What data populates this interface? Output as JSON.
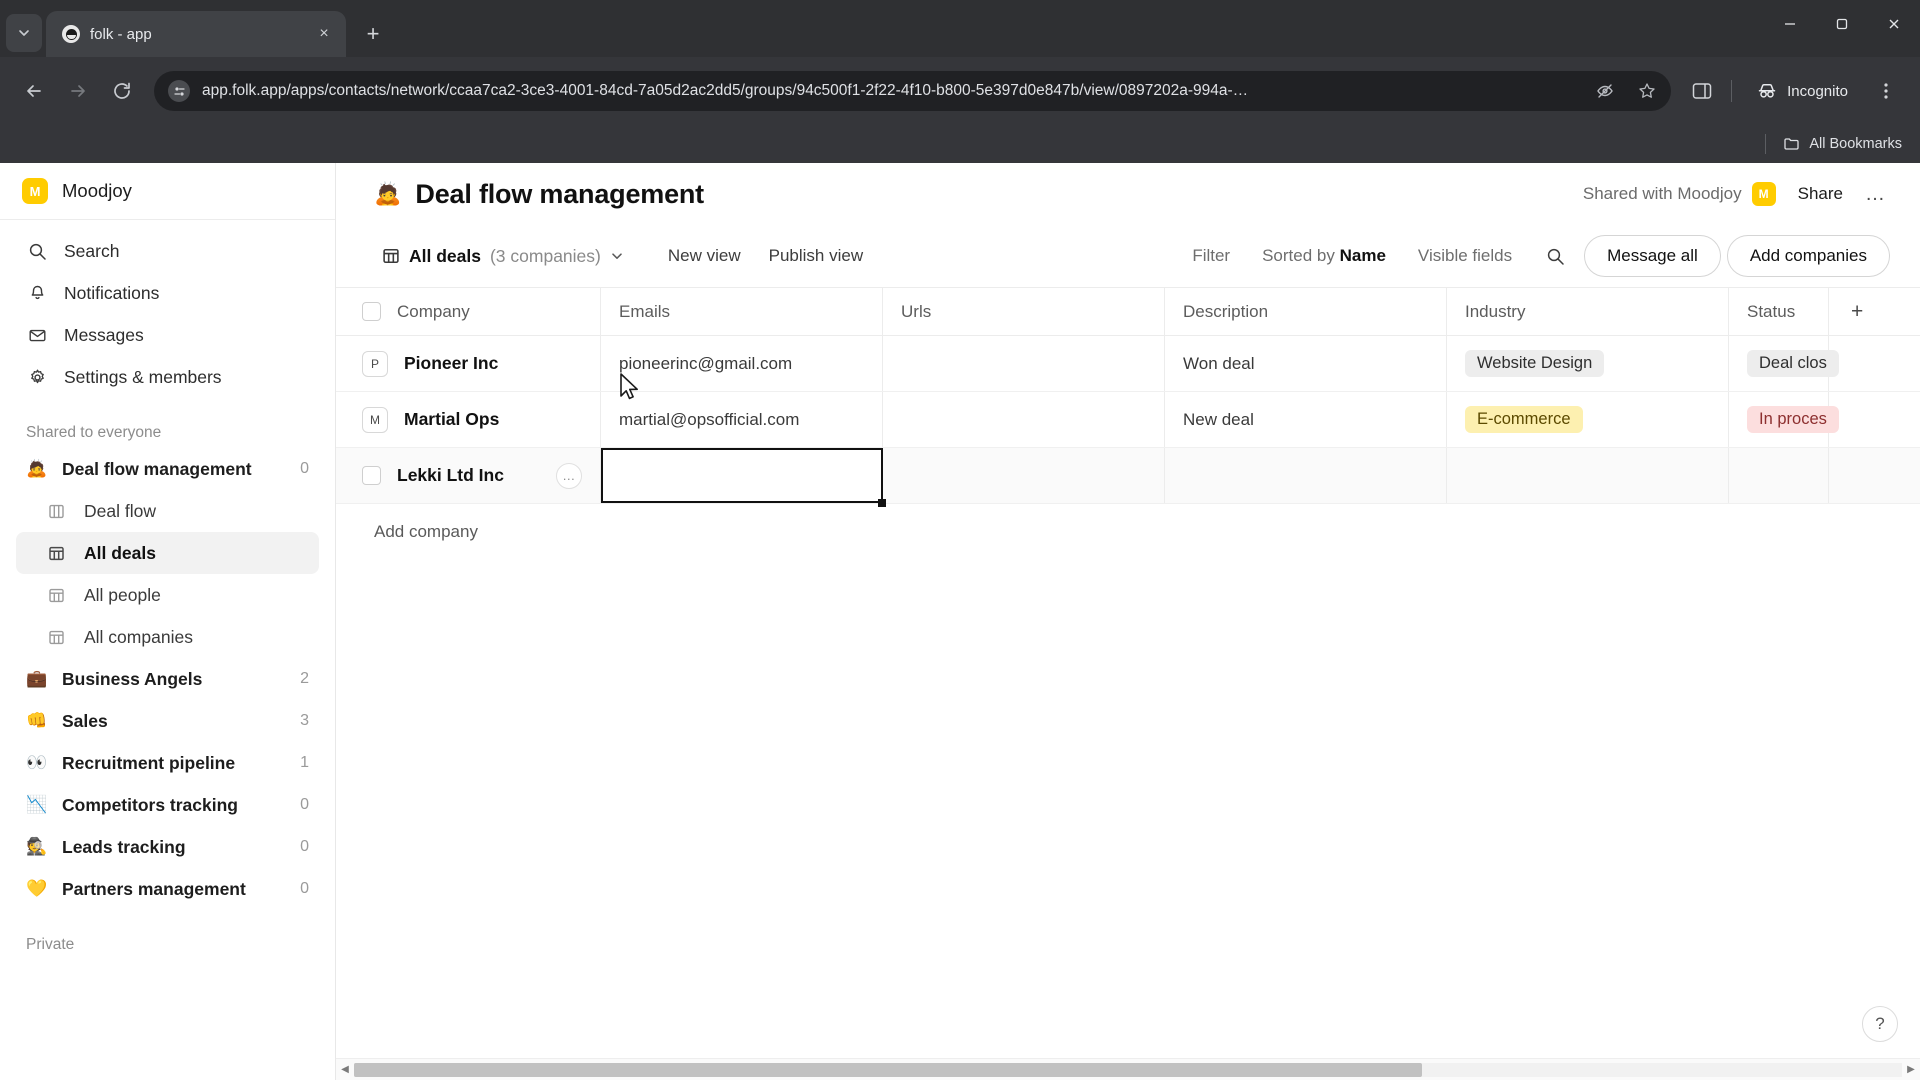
{
  "browser": {
    "tab": {
      "title": "folk - app",
      "favicon": "folk-logo-icon"
    },
    "tab_list_icon": "chevron-down-icon",
    "new_tab_icon": "plus-icon",
    "close_icon": "×",
    "window_controls": {
      "minimize": "—",
      "maximize": "❐",
      "close": "✕"
    },
    "nav": {
      "back": "←",
      "forward": "→",
      "reload": "⟳"
    },
    "omnibox": {
      "site_info_icon": "tune-icon",
      "url": "app.folk.app/apps/contacts/network/ccaa7ca2-3ce3-4001-84cd-7a05d2ac2dd5/groups/94c500f1-2f22-4f10-b800-5e397d0e847b/view/0897202a-994a-…",
      "hide_icon": "eye-slash-icon",
      "bookmark_icon": "star-icon"
    },
    "side_panel_icon": "side-panel-icon",
    "incognito": {
      "label": "Incognito",
      "icon": "incognito-icon"
    },
    "bookmarks": {
      "all_bookmarks": "All Bookmarks",
      "folder_icon": "folder-icon"
    }
  },
  "sidebar": {
    "workspace": {
      "name": "Moodjoy",
      "avatar_letter": "M",
      "avatar_color": "#FFCC00"
    },
    "nav": [
      {
        "label": "Search",
        "icon": "search-icon"
      },
      {
        "label": "Notifications",
        "icon": "bell-icon"
      },
      {
        "label": "Messages",
        "icon": "envelope-icon"
      },
      {
        "label": "Settings & members",
        "icon": "gear-icon"
      }
    ],
    "section_shared": "Shared to everyone",
    "groups": [
      {
        "label": "Deal flow management",
        "emoji": "🙇",
        "count": "0",
        "bold": true
      },
      {
        "label": "Deal flow",
        "icon": "board-icon",
        "sub": true,
        "active": false
      },
      {
        "label": "All deals",
        "icon": "table-icon",
        "sub": true,
        "active": true
      },
      {
        "label": "All people",
        "icon": "table-icon",
        "sub": true,
        "active": false
      },
      {
        "label": "All companies",
        "icon": "table-icon",
        "sub": true,
        "active": false
      },
      {
        "label": "Business Angels",
        "emoji": "💼",
        "count": "2"
      },
      {
        "label": "Sales",
        "emoji": "👊",
        "count": "3"
      },
      {
        "label": "Recruitment pipeline",
        "emoji": "👀",
        "count": "1"
      },
      {
        "label": "Competitors tracking",
        "emoji": "📉",
        "count": "0"
      },
      {
        "label": "Leads tracking",
        "emoji": "🕵️",
        "count": "0"
      },
      {
        "label": "Partners management",
        "emoji": "💛",
        "count": "0"
      }
    ],
    "section_private": "Private"
  },
  "header": {
    "emoji": "🙇",
    "title": "Deal flow management",
    "shared_with": "Shared with Moodjoy",
    "shared_avatar_letter": "M",
    "share_label": "Share",
    "more_icon": "…"
  },
  "toolbar": {
    "view_icon": "table-icon",
    "view_name": "All deals",
    "view_count": "(3 companies)",
    "chevron_icon": "chevron-down-icon",
    "new_view": "New view",
    "publish_view": "Publish view",
    "filter": "Filter",
    "sorted_by_prefix": "Sorted by ",
    "sorted_by_value": "Name",
    "visible_fields": "Visible fields",
    "search_icon": "search-icon",
    "message_all": "Message all",
    "add_companies": "Add companies"
  },
  "table": {
    "columns": [
      "Company",
      "Emails",
      "Urls",
      "Description",
      "Industry",
      "Status"
    ],
    "add_column_icon": "+",
    "rows": [
      {
        "company": "Pioneer Inc",
        "avatar_letter": "P",
        "email": "pioneerinc@gmail.com",
        "url": "",
        "description": "Won deal",
        "industry": "Website Design",
        "industry_color": "gray",
        "status": "Deal clos",
        "status_color": "gray",
        "checked": false
      },
      {
        "company": "Martial Ops",
        "avatar_letter": "M",
        "email": "martial@opsofficial.com",
        "url": "",
        "description": "New deal",
        "industry": "E-commerce",
        "industry_color": "yellow",
        "status": "In proces",
        "status_color": "pink",
        "checked": false
      },
      {
        "company": "Lekki Ltd Inc",
        "avatar_letter": "",
        "email": "",
        "url": "",
        "description": "",
        "industry": "",
        "industry_color": "",
        "status": "",
        "status_color": "",
        "checked": false,
        "row_more_icon": "…",
        "email_cell_selected": true
      }
    ],
    "add_company": "Add company"
  },
  "footer": {
    "help_icon": "?",
    "scroll_left_icon": "◀",
    "scroll_right_icon": "▶"
  }
}
